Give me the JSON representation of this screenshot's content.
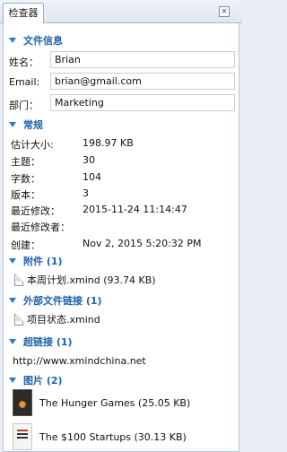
{
  "tab": {
    "label": "检查器"
  },
  "sections": {
    "file_info": {
      "title": "文件信息"
    },
    "general": {
      "title": "常规"
    },
    "attachments": {
      "title": "附件 (1)"
    },
    "external_links": {
      "title": "外部文件链接 (1)"
    },
    "hyperlinks": {
      "title": "超链接 (1)"
    },
    "images": {
      "title": "图片 (2)"
    }
  },
  "file_info": {
    "name_label": "姓名：",
    "name_value": "Brian",
    "email_label": "Email:",
    "email_value": "brian@gmail.com",
    "dept_label": "部门：",
    "dept_value": "Marketing"
  },
  "general": {
    "size_label": "估计大小:",
    "size_value": "198.97 KB",
    "topics_label": "主题：",
    "topics_value": "30",
    "words_label": "字数：",
    "words_value": "104",
    "version_label": "版本：",
    "version_value": "3",
    "modified_label": "最近修改：",
    "modified_value": "2015-11-24 11:14:47",
    "modifier_label": "最近修改者：",
    "modifier_value": "",
    "created_label": "创建：",
    "created_value": "Nov 2, 2015 5:20:32 PM"
  },
  "attachments": {
    "items": [
      "本周计划.xmind (93.74 KB)"
    ]
  },
  "external_links": {
    "items": [
      "项目状态.xmind"
    ]
  },
  "hyperlinks": {
    "items": [
      "http://www.xmindchina.net"
    ]
  },
  "images": {
    "items": [
      "The Hunger Games (25.05 KB)",
      "The $100 Startups (30.13 KB)"
    ]
  }
}
